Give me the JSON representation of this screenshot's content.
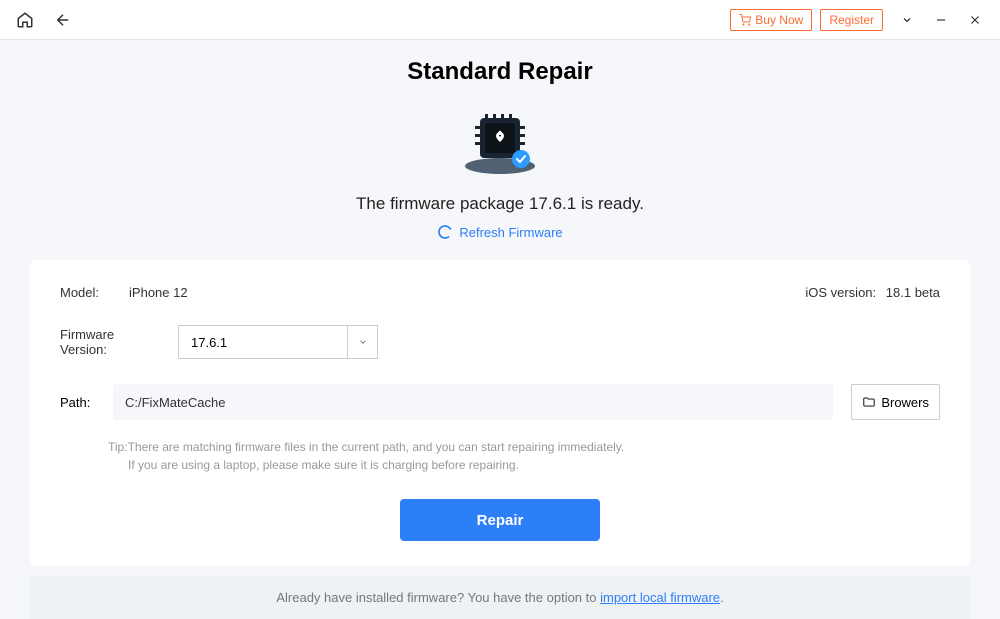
{
  "titlebar": {
    "buy_now": "Buy Now",
    "register": "Register"
  },
  "header": {
    "title": "Standard Repair",
    "status": "The firmware package 17.6.1 is ready.",
    "refresh": "Refresh Firmware"
  },
  "device": {
    "model_label": "Model:",
    "model_value": "iPhone 12",
    "ios_label": "iOS version:",
    "ios_value": "18.1 beta",
    "firmware_label": "Firmware Version:",
    "firmware_value": "17.6.1",
    "path_label": "Path:",
    "path_value": "C:/FixMateCache",
    "browse_label": "Browers"
  },
  "tip": {
    "prefix": "Tip:",
    "line1": "There are matching firmware files in the current path, and you can start repairing immediately.",
    "line2": "If you are using a laptop, please make sure it is charging before repairing."
  },
  "actions": {
    "repair": "Repair"
  },
  "footer": {
    "text": "Already have installed firmware? You have the option to ",
    "link": "import local firmware",
    "suffix": "."
  }
}
